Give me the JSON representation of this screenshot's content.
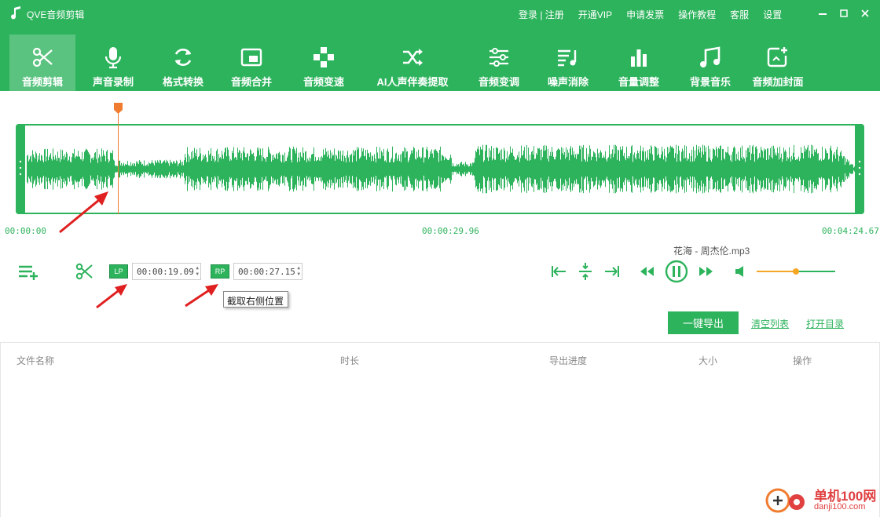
{
  "window": {
    "title": "QVE音频剪辑",
    "top_links": [
      "登录 | 注册",
      "开通VIP",
      "申请发票",
      "操作教程",
      "客服",
      "设置"
    ]
  },
  "toolbar": {
    "items": [
      {
        "label": "音频剪辑",
        "icon": "scissors-icon",
        "active": true
      },
      {
        "label": "声音录制",
        "icon": "microphone-icon"
      },
      {
        "label": "格式转换",
        "icon": "refresh-icon"
      },
      {
        "label": "音频合并",
        "icon": "merge-icon"
      },
      {
        "label": "音频变速",
        "icon": "speed-icon"
      },
      {
        "label": "AI人声伴奏提取",
        "icon": "shuffle-icon"
      },
      {
        "label": "音频变调",
        "icon": "sliders-icon"
      },
      {
        "label": "噪声消除",
        "icon": "noise-icon"
      },
      {
        "label": "音量调整",
        "icon": "volume-bars-icon"
      },
      {
        "label": "背景音乐",
        "icon": "music-note-icon"
      },
      {
        "label": "音频加封面",
        "icon": "cover-image-icon"
      }
    ]
  },
  "waveform": {
    "start_time": "00:00:00",
    "mid_time": "00:00:29.96",
    "end_time": "00:04:24.67",
    "color": "#2eb35d",
    "marker_color": "#f07c30"
  },
  "controls": {
    "file_name": "花海 - 周杰伦.mp3",
    "lp_label": "LP",
    "rp_label": "RP",
    "lp_time": "00:00:19.09",
    "rp_time": "00:00:27.15",
    "tooltip": "截取右侧位置",
    "volume_level": 0.5
  },
  "actions": {
    "export": "一键导出",
    "clear_list": "清空列表",
    "open_dir": "打开目录"
  },
  "table": {
    "columns": [
      "文件名称",
      "时长",
      "导出进度",
      "大小",
      "操作"
    ]
  },
  "watermark": {
    "text1": "单机100网",
    "text2": "danji100.com"
  }
}
